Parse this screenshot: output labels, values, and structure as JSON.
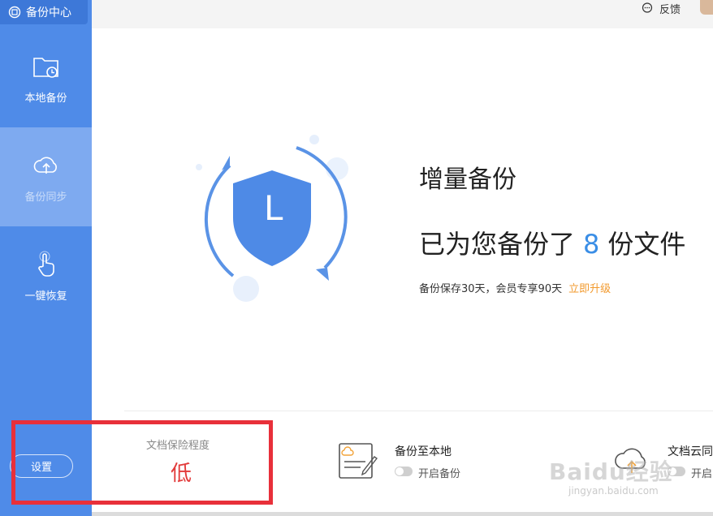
{
  "sidebar": {
    "brand_label": "备份中心",
    "items": [
      {
        "label": "本地备份",
        "icon": "folder-clock-icon"
      },
      {
        "label": "备份同步",
        "icon": "cloud-upload-icon"
      },
      {
        "label": "一键恢复",
        "icon": "hand-pointer-icon"
      }
    ],
    "settings_label": "设置"
  },
  "topbar": {
    "feedback_label": "反馈"
  },
  "main": {
    "shield_letter": "L",
    "title": "增量备份",
    "count_prefix": "已为您备份了",
    "count": "8",
    "count_suffix": "份文件",
    "sub_text": "备份保存30天，会员专享90天",
    "upgrade_label": "立即升级"
  },
  "bottom": {
    "level_label": "文档保险程度",
    "level_value": "低",
    "local": {
      "title": "备份至本地",
      "toggle_label": "开启备份"
    },
    "cloud": {
      "title": "文档云同",
      "toggle_label": "开启"
    }
  },
  "watermark": {
    "logo": "Baidu经验",
    "url": "jingyan.baidu.com"
  },
  "colors": {
    "sidebar": "#4f8be8",
    "accent_blue": "#3a8ee6",
    "upgrade_orange": "#f29a2e",
    "level_red": "#e23b3b",
    "highlight_red": "#e8303a"
  }
}
